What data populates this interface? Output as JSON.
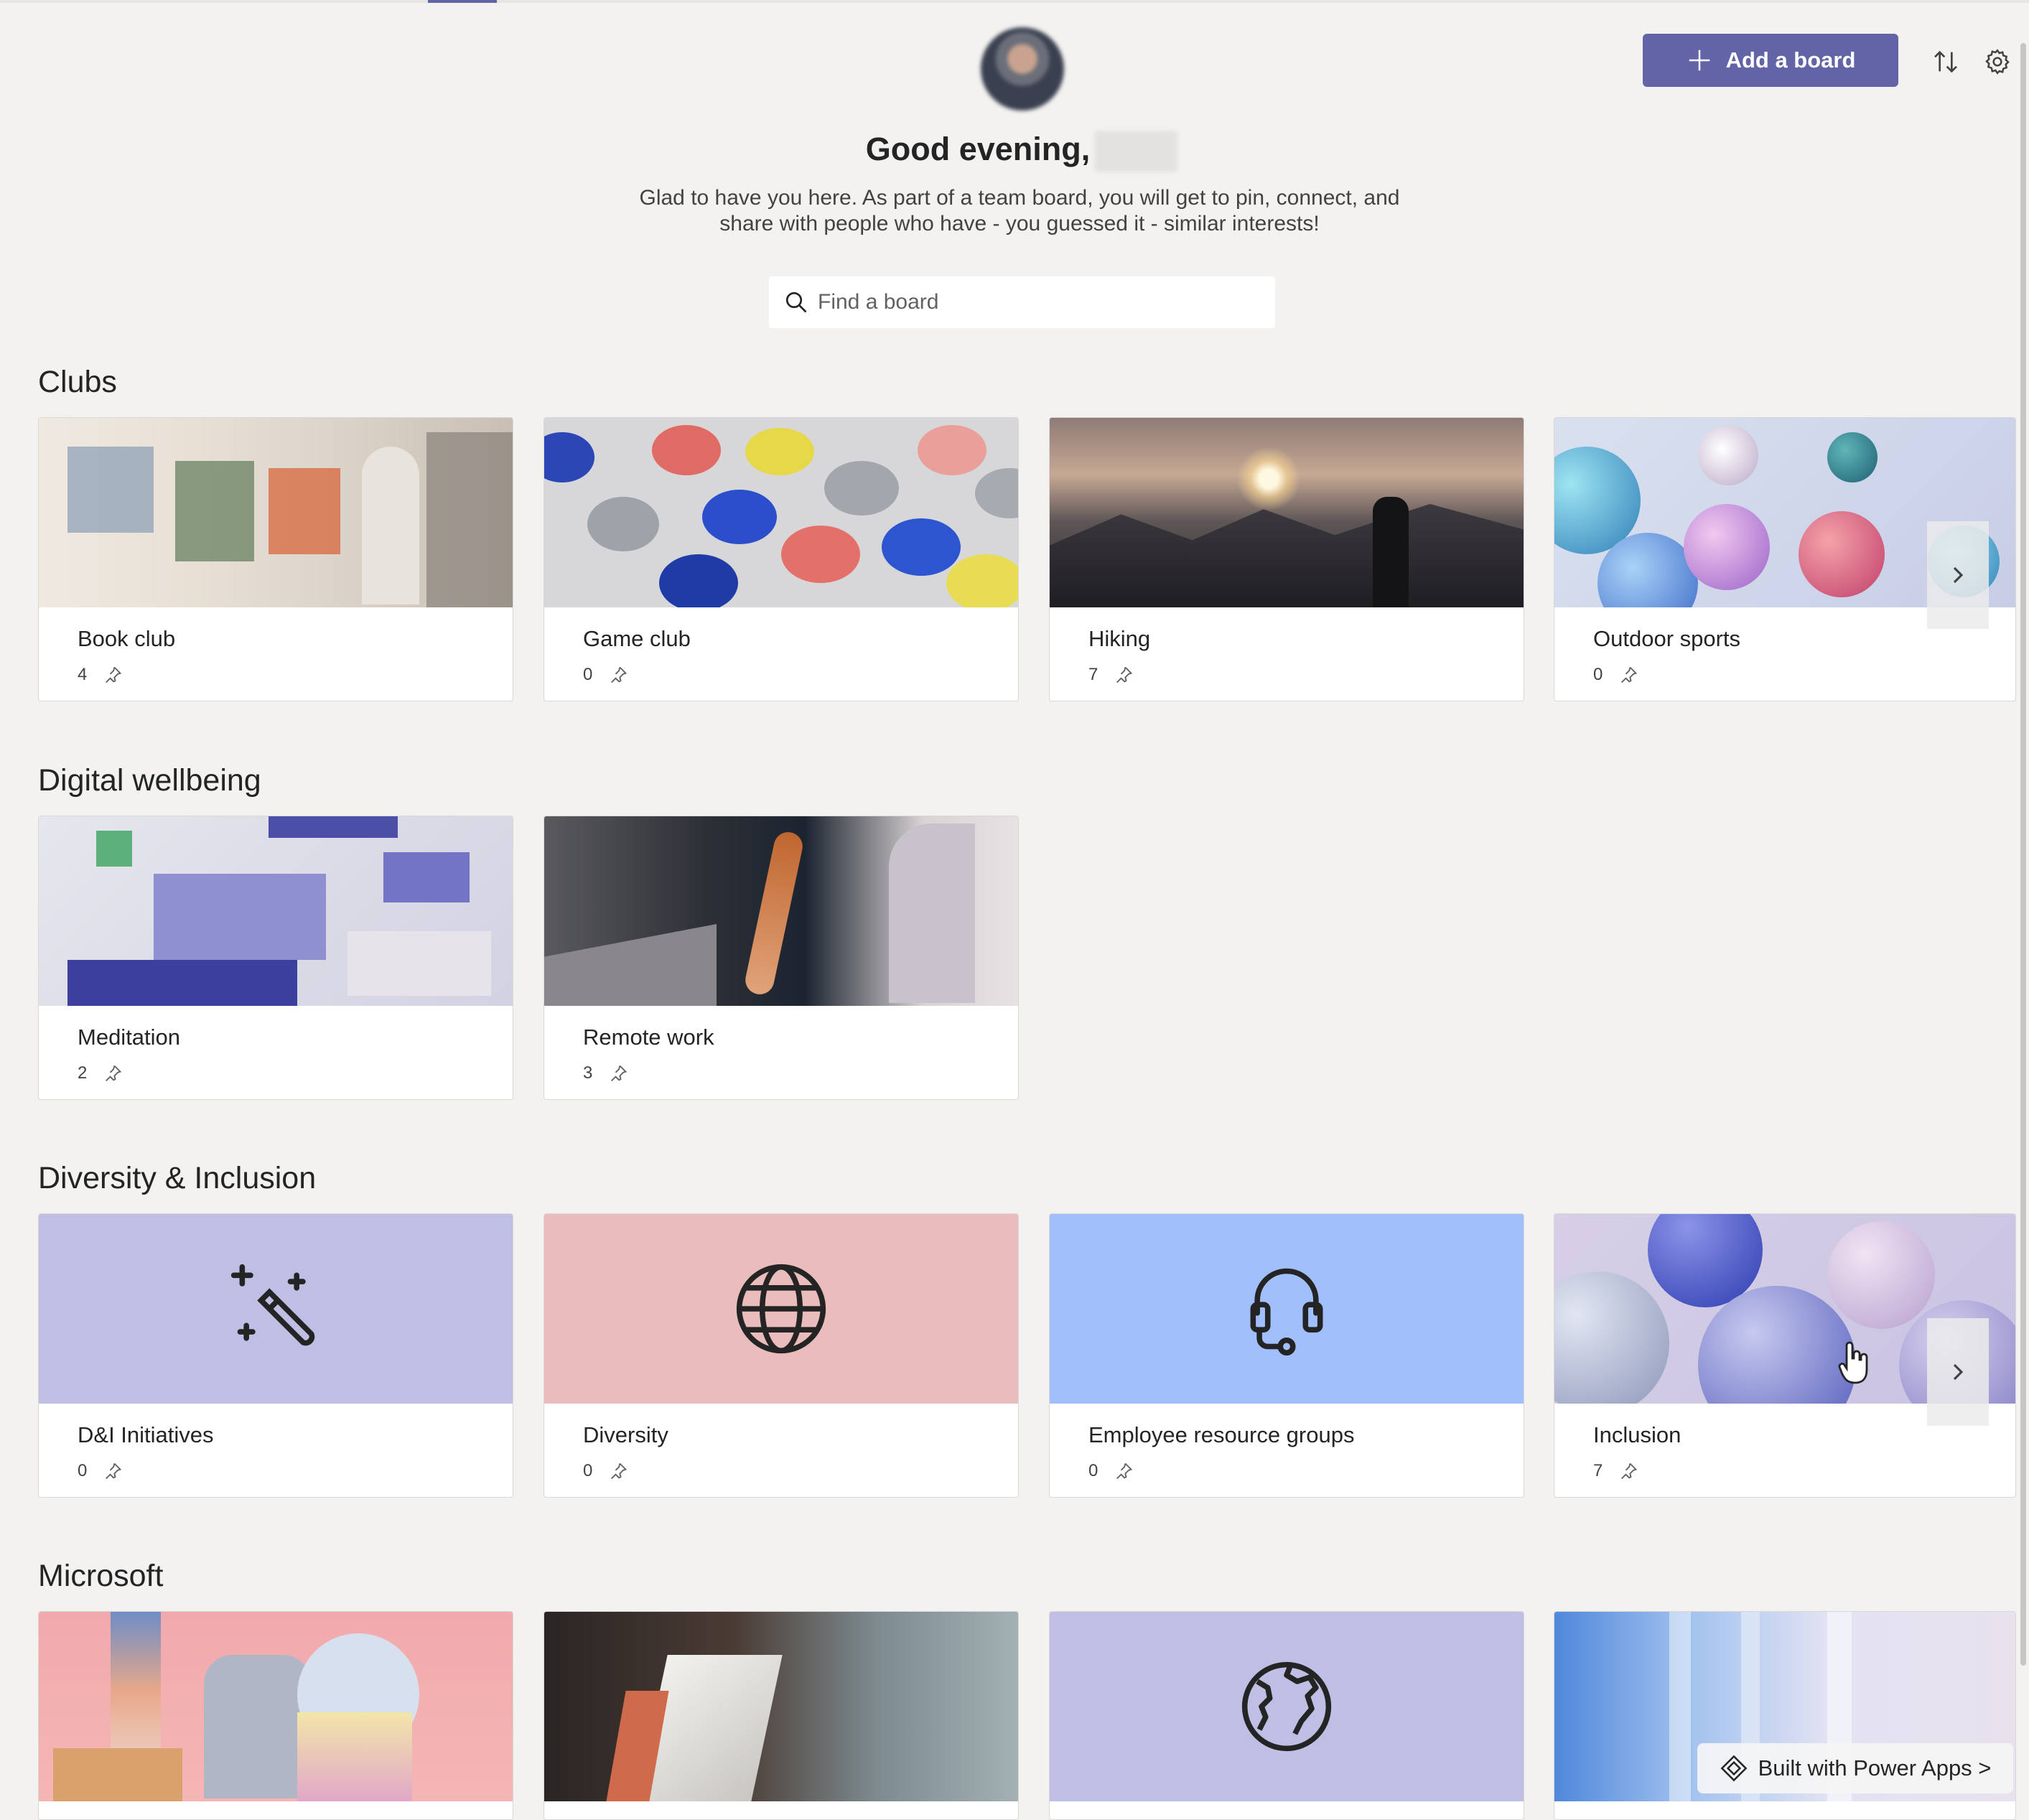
{
  "header": {
    "greeting": "Good evening,",
    "intro": "Glad to have you here. As part of a team board, you will get to pin, connect, and share with people who have - you guessed it - similar interests!",
    "add_board_label": "Add a board",
    "search_placeholder": "Find a board"
  },
  "colors": {
    "accent": "#6264a7",
    "background": "#f3f2f1",
    "tile_purple": "#bfbfe6",
    "tile_pink": "#ebbcbc",
    "tile_blue": "#a1bffa"
  },
  "sections": [
    {
      "title": "Clubs",
      "cards": [
        {
          "title": "Book club",
          "count": "4"
        },
        {
          "title": "Game club",
          "count": "0"
        },
        {
          "title": "Hiking",
          "count": "7"
        },
        {
          "title": "Outdoor sports",
          "count": "0"
        }
      ]
    },
    {
      "title": "Digital wellbeing",
      "cards": [
        {
          "title": "Meditation",
          "count": "2"
        },
        {
          "title": "Remote work",
          "count": "3"
        }
      ]
    },
    {
      "title": "Diversity & Inclusion",
      "cards": [
        {
          "title": "D&I Initiatives",
          "count": "0",
          "icon": "magic-wand-icon"
        },
        {
          "title": "Diversity",
          "count": "0",
          "icon": "globe-icon"
        },
        {
          "title": "Employee resource groups",
          "count": "0",
          "icon": "headset-icon"
        },
        {
          "title": "Inclusion",
          "count": "7"
        }
      ]
    },
    {
      "title": "Microsoft",
      "cards": [
        {
          "title": ""
        },
        {
          "title": ""
        },
        {
          "title": "",
          "icon": "earth-icon"
        },
        {
          "title": ""
        }
      ]
    }
  ],
  "footer": {
    "powerapps_label": "Built with Power Apps >"
  }
}
